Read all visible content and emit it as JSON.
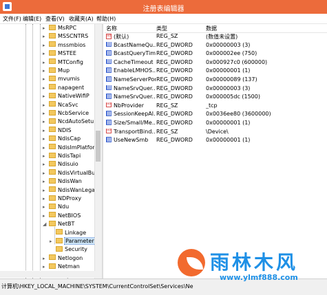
{
  "window": {
    "title": "注册表编辑器"
  },
  "menu": [
    "文件(F)",
    "编辑(E)",
    "查看(V)",
    "收藏夹(A)",
    "帮助(H)"
  ],
  "tree": [
    {
      "label": "MsRPC",
      "expander": "▸"
    },
    {
      "label": "MSSCNTRS",
      "expander": "▸"
    },
    {
      "label": "mssmbios",
      "expander": "▸"
    },
    {
      "label": "MSTEE",
      "expander": "▸"
    },
    {
      "label": "MTConfig",
      "expander": "▸"
    },
    {
      "label": "Mup",
      "expander": "▸"
    },
    {
      "label": "mvumis",
      "expander": "▸"
    },
    {
      "label": "napagent",
      "expander": "▸"
    },
    {
      "label": "NativeWifiP",
      "expander": "▸"
    },
    {
      "label": "NcaSvc",
      "expander": "▸"
    },
    {
      "label": "NcbService",
      "expander": "▸"
    },
    {
      "label": "NcdAutoSetup",
      "expander": "▸"
    },
    {
      "label": "NDIS",
      "expander": "▸"
    },
    {
      "label": "NdisCap",
      "expander": "▸"
    },
    {
      "label": "NdisImPlatform",
      "expander": "▸"
    },
    {
      "label": "NdisTapi",
      "expander": "▸"
    },
    {
      "label": "Ndisuio",
      "expander": "▸"
    },
    {
      "label": "NdisVirtualBus",
      "expander": "▸"
    },
    {
      "label": "NdisWan",
      "expander": "▸"
    },
    {
      "label": "NdisWanLegacy",
      "expander": "▸"
    },
    {
      "label": "NDProxy",
      "expander": "▸"
    },
    {
      "label": "Ndu",
      "expander": "▸"
    },
    {
      "label": "NetBIOS",
      "expander": "▸"
    },
    {
      "label": "NetBT",
      "expander": "◢"
    },
    {
      "label": "Linkage",
      "expander": ""
    },
    {
      "label": "Parameters",
      "expander": "▸"
    },
    {
      "label": "Security",
      "expander": ""
    },
    {
      "label": "Netlogon",
      "expander": "▸"
    },
    {
      "label": "Netman",
      "expander": "▸"
    },
    {
      "label": "netprofm",
      "expander": "▸"
    }
  ],
  "columns": {
    "name": "名称",
    "type": "类型",
    "data": "数据"
  },
  "values": [
    {
      "name": "(默认)",
      "type": "REG_SZ",
      "data": "(数值未设置)",
      "kind": "str"
    },
    {
      "name": "BcastNameQu...",
      "type": "REG_DWORD",
      "data": "0x00000003 (3)",
      "kind": "num"
    },
    {
      "name": "BcastQueryTim...",
      "type": "REG_DWORD",
      "data": "0x000002ee (750)",
      "kind": "num"
    },
    {
      "name": "CacheTimeout",
      "type": "REG_DWORD",
      "data": "0x000927c0 (600000)",
      "kind": "num"
    },
    {
      "name": "EnableLMHOS...",
      "type": "REG_DWORD",
      "data": "0x00000001 (1)",
      "kind": "num"
    },
    {
      "name": "NameServerPort",
      "type": "REG_DWORD",
      "data": "0x00000089 (137)",
      "kind": "num"
    },
    {
      "name": "NameSrvQuer...",
      "type": "REG_DWORD",
      "data": "0x00000003 (3)",
      "kind": "num"
    },
    {
      "name": "NameSrvQuer...",
      "type": "REG_DWORD",
      "data": "0x000005dc (1500)",
      "kind": "num"
    },
    {
      "name": "NbProvider",
      "type": "REG_SZ",
      "data": "_tcp",
      "kind": "str"
    },
    {
      "name": "SessionKeepAl...",
      "type": "REG_DWORD",
      "data": "0x0036ee80 (3600000)",
      "kind": "num"
    },
    {
      "name": "Size/Small/Me...",
      "type": "REG_DWORD",
      "data": "0x00000001 (1)",
      "kind": "num"
    },
    {
      "name": "TransportBind...",
      "type": "REG_SZ",
      "data": "\\Device\\",
      "kind": "str"
    },
    {
      "name": "UseNewSmb",
      "type": "REG_DWORD",
      "data": "0x00000001 (1)",
      "kind": "num"
    }
  ],
  "status": {
    "path": "计算机\\HKEY_LOCAL_MACHINE\\SYSTEM\\CurrentControlSet\\Services\\Ne"
  },
  "watermark": {
    "text": "雨林木风",
    "url": "www.ylmf888.com"
  },
  "colors": {
    "titlebar": "#ec6b3b",
    "watermark": "#1e90e6",
    "selection": "#cce4f7"
  }
}
